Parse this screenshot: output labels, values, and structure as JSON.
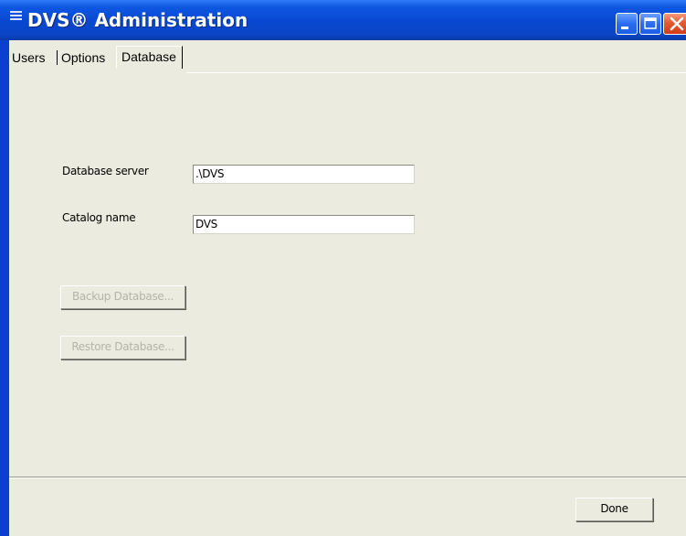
{
  "window": {
    "title": "DVS® Administration",
    "icons": {
      "app": "menu-icon",
      "minimize": "minimize-icon",
      "maximize": "maximize-icon",
      "close": "close-icon"
    }
  },
  "tabs": [
    {
      "label": "Users",
      "selected": false
    },
    {
      "label": "Options",
      "selected": false
    },
    {
      "label": "Database",
      "selected": true
    }
  ],
  "form": {
    "server_label": "Database server",
    "server_value": ".\\DVS",
    "catalog_label": "Catalog name",
    "catalog_value": "DVS"
  },
  "actions": {
    "backup_label": "Backup Database...",
    "backup_enabled": false,
    "restore_label": "Restore Database...",
    "restore_enabled": false
  },
  "footer": {
    "done_label": "Done"
  },
  "colors": {
    "titlebar": "#0a46c7",
    "client_background": "#ecebdf",
    "close_button": "#d13c18",
    "disabled_text": "#b5b4aa"
  }
}
